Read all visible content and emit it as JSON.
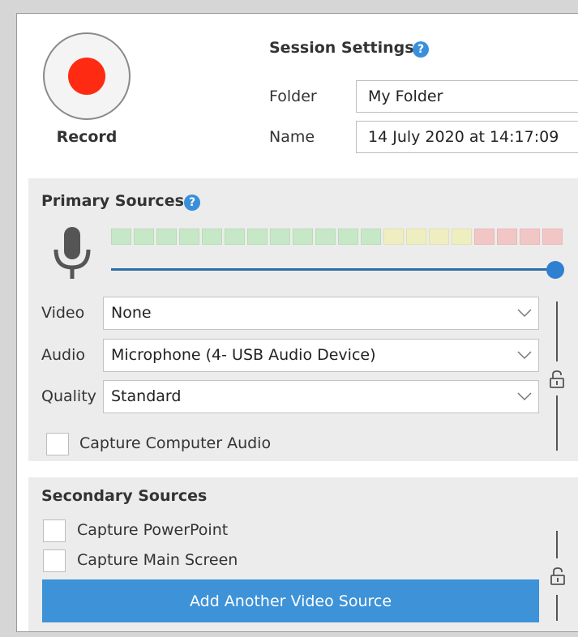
{
  "record": {
    "label": "Record",
    "dot_color": "#ff2a12"
  },
  "session": {
    "title": "Session Settings",
    "help": "?",
    "folder_label": "Folder",
    "folder_value": "My Folder",
    "name_label": "Name",
    "name_value": "14 July 2020 at 14:17:09"
  },
  "primary": {
    "title": "Primary Sources",
    "help": "?",
    "meter": {
      "segment_colors": [
        "#c6e8c6",
        "#c6e8c6",
        "#c6e8c6",
        "#c6e8c6",
        "#c6e8c6",
        "#c6e8c6",
        "#c6e8c6",
        "#c6e8c6",
        "#c6e8c6",
        "#c6e8c6",
        "#c6e8c6",
        "#c6e8c6",
        "#eeeec0",
        "#eeeec0",
        "#eeeec0",
        "#eeeec0",
        "#f3c6c6",
        "#f3c6c6",
        "#f3c6c6",
        "#f3c6c6"
      ]
    },
    "volume_level_percent": 100,
    "video_label": "Video",
    "video_value": "None",
    "audio_label": "Audio",
    "audio_value": "Microphone (4- USB Audio Device)",
    "quality_label": "Quality",
    "quality_value": "Standard",
    "capture_audio_label": "Capture Computer Audio",
    "capture_audio_checked": false
  },
  "secondary": {
    "title": "Secondary Sources",
    "capture_ppt_label": "Capture PowerPoint",
    "capture_screen_label": "Capture Main Screen",
    "add_button_label": "Add Another Video Source"
  },
  "colors": {
    "accent": "#3d92d8",
    "help_icon": "#3a8fdb",
    "panel_bg": "#ececec"
  }
}
